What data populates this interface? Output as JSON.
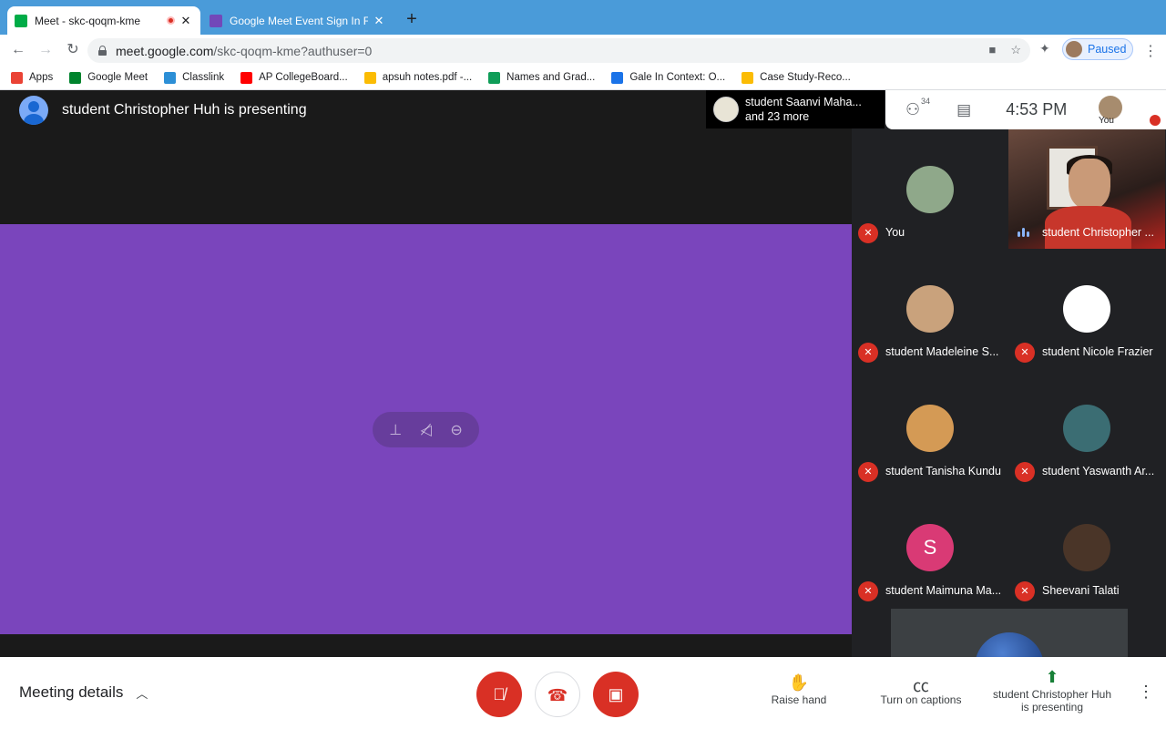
{
  "browser": {
    "tabs": [
      {
        "title": "Meet - skc-qoqm-kme",
        "active": true,
        "favicon": "meet-icon",
        "close": "✕"
      },
      {
        "title": "Google Meet Event Sign In For",
        "active": false,
        "favicon": "forms-icon",
        "close": "✕"
      }
    ],
    "new_tab": "+",
    "url_host": "meet.google.com",
    "url_path": "/skc-qoqm-kme?authuser=0",
    "profile_label": "Paused",
    "bookmarks": [
      {
        "label": "Apps",
        "icon": "apps-grid-icon",
        "color": "#ea4335"
      },
      {
        "label": "Google Meet",
        "icon": "meet-icon",
        "color": "#00832d"
      },
      {
        "label": "Classlink",
        "icon": "classlink-icon",
        "color": "#2c8fd6"
      },
      {
        "label": "AP CollegeBoard...",
        "icon": "youtube-icon",
        "color": "#ff0000"
      },
      {
        "label": "apsuh notes.pdf -...",
        "icon": "drive-icon",
        "color": "#fbbc04"
      },
      {
        "label": "Names and Grad...",
        "icon": "sheets-icon",
        "color": "#0f9d58"
      },
      {
        "label": "Gale In Context: O...",
        "icon": "gale-icon",
        "color": "#1a73e8"
      },
      {
        "label": "Case Study-Reco...",
        "icon": "drive-icon",
        "color": "#fbbc04"
      }
    ]
  },
  "meet": {
    "presenting_banner": "student Christopher Huh is presenting",
    "notification": {
      "line1": "student Saanvi Maha...",
      "line2": "and 23 more"
    },
    "participants_count": "34",
    "time": "4:53 PM",
    "self_label": "You",
    "tiles": [
      {
        "name": "You",
        "type": "avatar",
        "color": "#8fa88a"
      },
      {
        "name": "student Christopher ...",
        "type": "video"
      },
      {
        "name": "student Madeleine S...",
        "type": "avatar",
        "color": "#c9a27c"
      },
      {
        "name": "student Nicole Frazier",
        "type": "avatar",
        "color": "#ffffff"
      },
      {
        "name": "student Tanisha Kundu",
        "type": "avatar",
        "color": "#d49a55"
      },
      {
        "name": "student Yaswanth Ar...",
        "type": "avatar",
        "color": "#3b6d73"
      },
      {
        "name": "student Maimuna Ma...",
        "type": "letter",
        "letter": "S",
        "color": "#d93a75"
      },
      {
        "name": "Sheevani Talati",
        "type": "avatar",
        "color": "#4a3528"
      }
    ],
    "bottom": {
      "meeting_details": "Meeting details",
      "raise_hand": "Raise hand",
      "captions": "Turn on captions",
      "presenting_line1": "student Christopher Huh",
      "presenting_line2": "is presenting"
    }
  },
  "colors": {
    "share_bg": "#7a45bc",
    "danger": "#d93025",
    "tab_strip": "#4a9bd9"
  }
}
